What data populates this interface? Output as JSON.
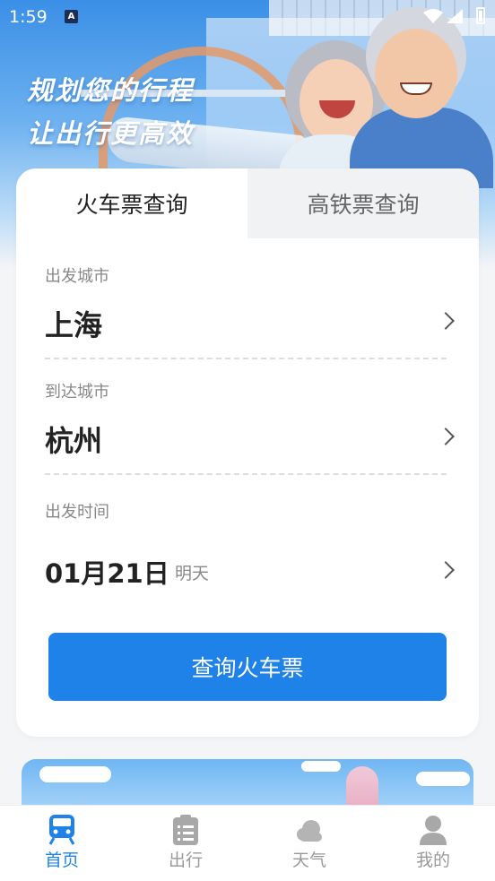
{
  "status_bar": {
    "time": "1:59",
    "notification_icon": "A"
  },
  "hero": {
    "slogan_line1": "规划您的行程",
    "slogan_line2": "让出行更高效"
  },
  "tabs": [
    {
      "label": "火车票查询",
      "active": true
    },
    {
      "label": "高铁票查询",
      "active": false
    }
  ],
  "form": {
    "departure": {
      "label": "出发城市",
      "value": "上海"
    },
    "arrival": {
      "label": "到达城市",
      "value": "杭州"
    },
    "date": {
      "label": "出发时间",
      "value": "01月21日",
      "sub": "明天"
    }
  },
  "query_button_label": "查询火车票",
  "bottom_nav": [
    {
      "label": "首页",
      "icon": "train-icon",
      "active": true
    },
    {
      "label": "出行",
      "icon": "clipboard-list-icon",
      "active": false
    },
    {
      "label": "天气",
      "icon": "cloud-icon",
      "active": false
    },
    {
      "label": "我的",
      "icon": "person-icon",
      "active": false
    }
  ],
  "colors": {
    "accent": "#1f82e8",
    "inactive": "#999999"
  }
}
